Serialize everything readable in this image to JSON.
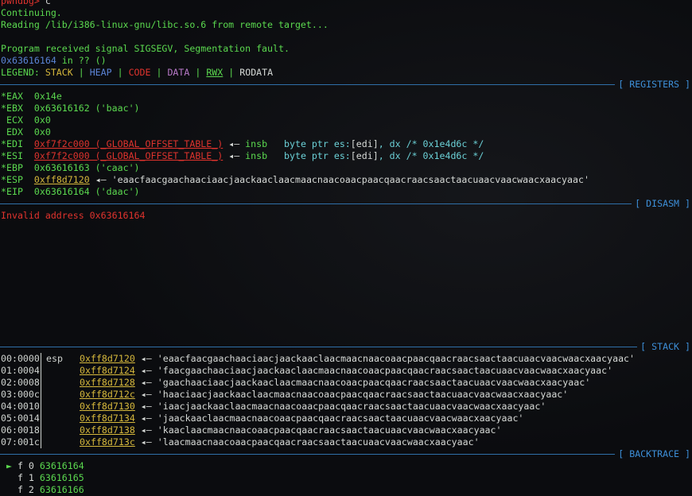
{
  "prompt": {
    "label": "pwndbg> ",
    "command": "c"
  },
  "messages": [
    "Continuing.",
    "Reading /lib/i386-linux-gnu/libc.so.6 from remote target...",
    "",
    "Program received signal SIGSEGV, Segmentation fault."
  ],
  "pc_line": {
    "addr": "0x63616164",
    "rest": " in ?? ()"
  },
  "legend": {
    "label": "LEGEND: ",
    "items": [
      "STACK",
      "HEAP",
      "CODE",
      "DATA",
      "RWX",
      "RODATA"
    ],
    "sep": " | "
  },
  "sections": {
    "registers": "[ REGISTERS ]",
    "disasm": "[ DISASM ]",
    "stack": "[ STACK ]",
    "backtrace": "[ BACKTRACE ]"
  },
  "registers": [
    {
      "mark": "*",
      "name": "EAX",
      "value": "0x14e"
    },
    {
      "mark": "*",
      "name": "EBX",
      "value": "0x63616162 ('baac')"
    },
    {
      "mark": " ",
      "name": "ECX",
      "value": "0x0"
    },
    {
      "mark": " ",
      "name": "EDX",
      "value": "0x0"
    },
    {
      "mark": "*",
      "name": "EDI",
      "addr": "0xf7f2c000 (_GLOBAL_OFFSET_TABLE_)",
      "arrow": " ◂— ",
      "insn": "insb",
      "ops_pre": "byte ptr es:",
      "ops_br": "[edi]",
      "ops_post": ", dx ",
      "comment": "/* 0x1e4d6c */"
    },
    {
      "mark": "*",
      "name": "ESI",
      "addr": "0xf7f2c000 (_GLOBAL_OFFSET_TABLE_)",
      "arrow": " ◂— ",
      "insn": "insb",
      "ops_pre": "byte ptr es:",
      "ops_br": "[edi]",
      "ops_post": ", dx ",
      "comment": "/* 0x1e4d6c */"
    },
    {
      "mark": "*",
      "name": "EBP",
      "value": "0x63616163 ('caac')"
    },
    {
      "mark": "*",
      "name": "ESP",
      "addr": "0xff8d7120",
      "arrow": " ◂— ",
      "string": "'eaacfaacgaachaaciaacjaackaaclaacmaacnaacoaacpaacqaacraacsaactaacuaacvaacwaacxaacyaac'"
    },
    {
      "mark": "*",
      "name": "EIP",
      "value": "0x63616164 ('daac')"
    }
  ],
  "disasm_error": "Invalid address 0x63616164",
  "stack": [
    {
      "off": "00:0000",
      "reg": "esp",
      "addr": "0xff8d7120",
      "str": "'eaacfaacgaachaaciaacjaackaaclaacmaacnaacoaacpaacqaacraacsaactaacuaacvaacwaacxaacyaac'"
    },
    {
      "off": "01:0004",
      "reg": "",
      "addr": "0xff8d7124",
      "str": "'faacgaachaaciaacjaackaaclaacmaacnaacoaacpaacqaacraacsaactaacuaacvaacwaacxaacyaac'"
    },
    {
      "off": "02:0008",
      "reg": "",
      "addr": "0xff8d7128",
      "str": "'gaachaaciaacjaackaaclaacmaacnaacoaacpaacqaacraacsaactaacuaacvaacwaacxaacyaac'"
    },
    {
      "off": "03:000c",
      "reg": "",
      "addr": "0xff8d712c",
      "str": "'haaciaacjaackaaclaacmaacnaacoaacpaacqaacraacsaactaacuaacvaacwaacxaacyaac'"
    },
    {
      "off": "04:0010",
      "reg": "",
      "addr": "0xff8d7130",
      "str": "'iaacjaackaaclaacmaacnaacoaacpaacqaacraacsaactaacuaacvaacwaacxaacyaac'"
    },
    {
      "off": "05:0014",
      "reg": "",
      "addr": "0xff8d7134",
      "str": "'jaackaaclaacmaacnaacoaacpaacqaacraacsaactaacuaacvaacwaacxaacyaac'"
    },
    {
      "off": "06:0018",
      "reg": "",
      "addr": "0xff8d7138",
      "str": "'kaaclaacmaacnaacoaacpaacqaacraacsaactaacuaacvaacwaacxaacyaac'"
    },
    {
      "off": "07:001c",
      "reg": "",
      "addr": "0xff8d713c",
      "str": "'laacmaacnaacoaacpaacqaacraacsaactaacuaacvaacwaacxaacyaac'"
    }
  ],
  "stack_arrow": " ◂— ",
  "backtrace": [
    {
      "marker": " ► ",
      "label": "f 0 ",
      "addr": "63616164"
    },
    {
      "marker": "   ",
      "label": "f 1 ",
      "addr": "63616165"
    },
    {
      "marker": "   ",
      "label": "f 2 ",
      "addr": "63616166"
    }
  ],
  "colors": {
    "green": "#5bd94f",
    "red": "#e0332d",
    "yellow": "#d6b83c",
    "blue": "#5b84d6",
    "purple": "#b779c7",
    "separator": "#3d8fd8"
  }
}
